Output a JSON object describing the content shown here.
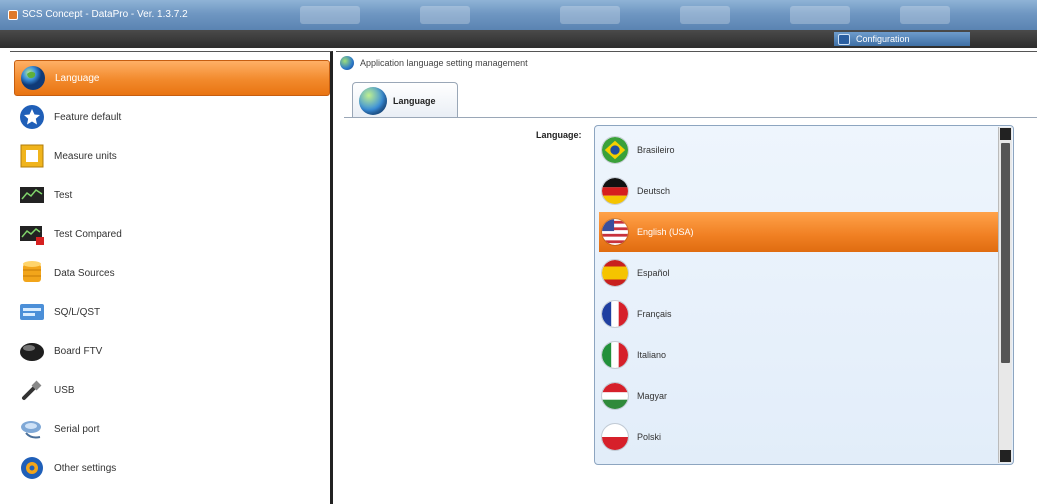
{
  "window": {
    "title": "SCS Concept - DataPro - Ver. 1.3.7.2"
  },
  "toolbar": {
    "config_label": "Configuration"
  },
  "sidebar": {
    "items": [
      {
        "label": "Language",
        "icon": "globe-icon",
        "active": true
      },
      {
        "label": "Feature default",
        "icon": "star-badge-icon",
        "active": false
      },
      {
        "label": "Measure units",
        "icon": "ruler-frame-icon",
        "active": false
      },
      {
        "label": "Test",
        "icon": "monitor-icon",
        "active": false
      },
      {
        "label": "Test Compared",
        "icon": "monitor-compare-icon",
        "active": false
      },
      {
        "label": "Data Sources",
        "icon": "database-icon",
        "active": false
      },
      {
        "label": "SQ/L/QST",
        "icon": "sql-icon",
        "active": false
      },
      {
        "label": "Board FTV",
        "icon": "board-icon",
        "active": false
      },
      {
        "label": "USB",
        "icon": "usb-icon",
        "active": false
      },
      {
        "label": "Serial port",
        "icon": "serial-port-icon",
        "active": false
      },
      {
        "label": "Other settings",
        "icon": "gear-icon",
        "active": false
      }
    ]
  },
  "main": {
    "breadcrumb": "Application language setting management",
    "tab_label": "Language",
    "field_label": "Language:",
    "languages": [
      {
        "name": "Brasileiro",
        "flag": "brazil-flag-icon",
        "selected": false
      },
      {
        "name": "Deutsch",
        "flag": "germany-flag-icon",
        "selected": false
      },
      {
        "name": "English (USA)",
        "flag": "usa-flag-icon",
        "selected": true
      },
      {
        "name": "Español",
        "flag": "spain-flag-icon",
        "selected": false
      },
      {
        "name": "Français",
        "flag": "france-flag-icon",
        "selected": false
      },
      {
        "name": "Italiano",
        "flag": "italy-flag-icon",
        "selected": false
      },
      {
        "name": "Magyar",
        "flag": "hungary-flag-icon",
        "selected": false
      },
      {
        "name": "Polski",
        "flag": "poland-flag-icon",
        "selected": false
      }
    ]
  },
  "colors": {
    "accent": "#f28a2c",
    "titlebar": "#6f97c2",
    "listbox": "#e6f0fb"
  }
}
